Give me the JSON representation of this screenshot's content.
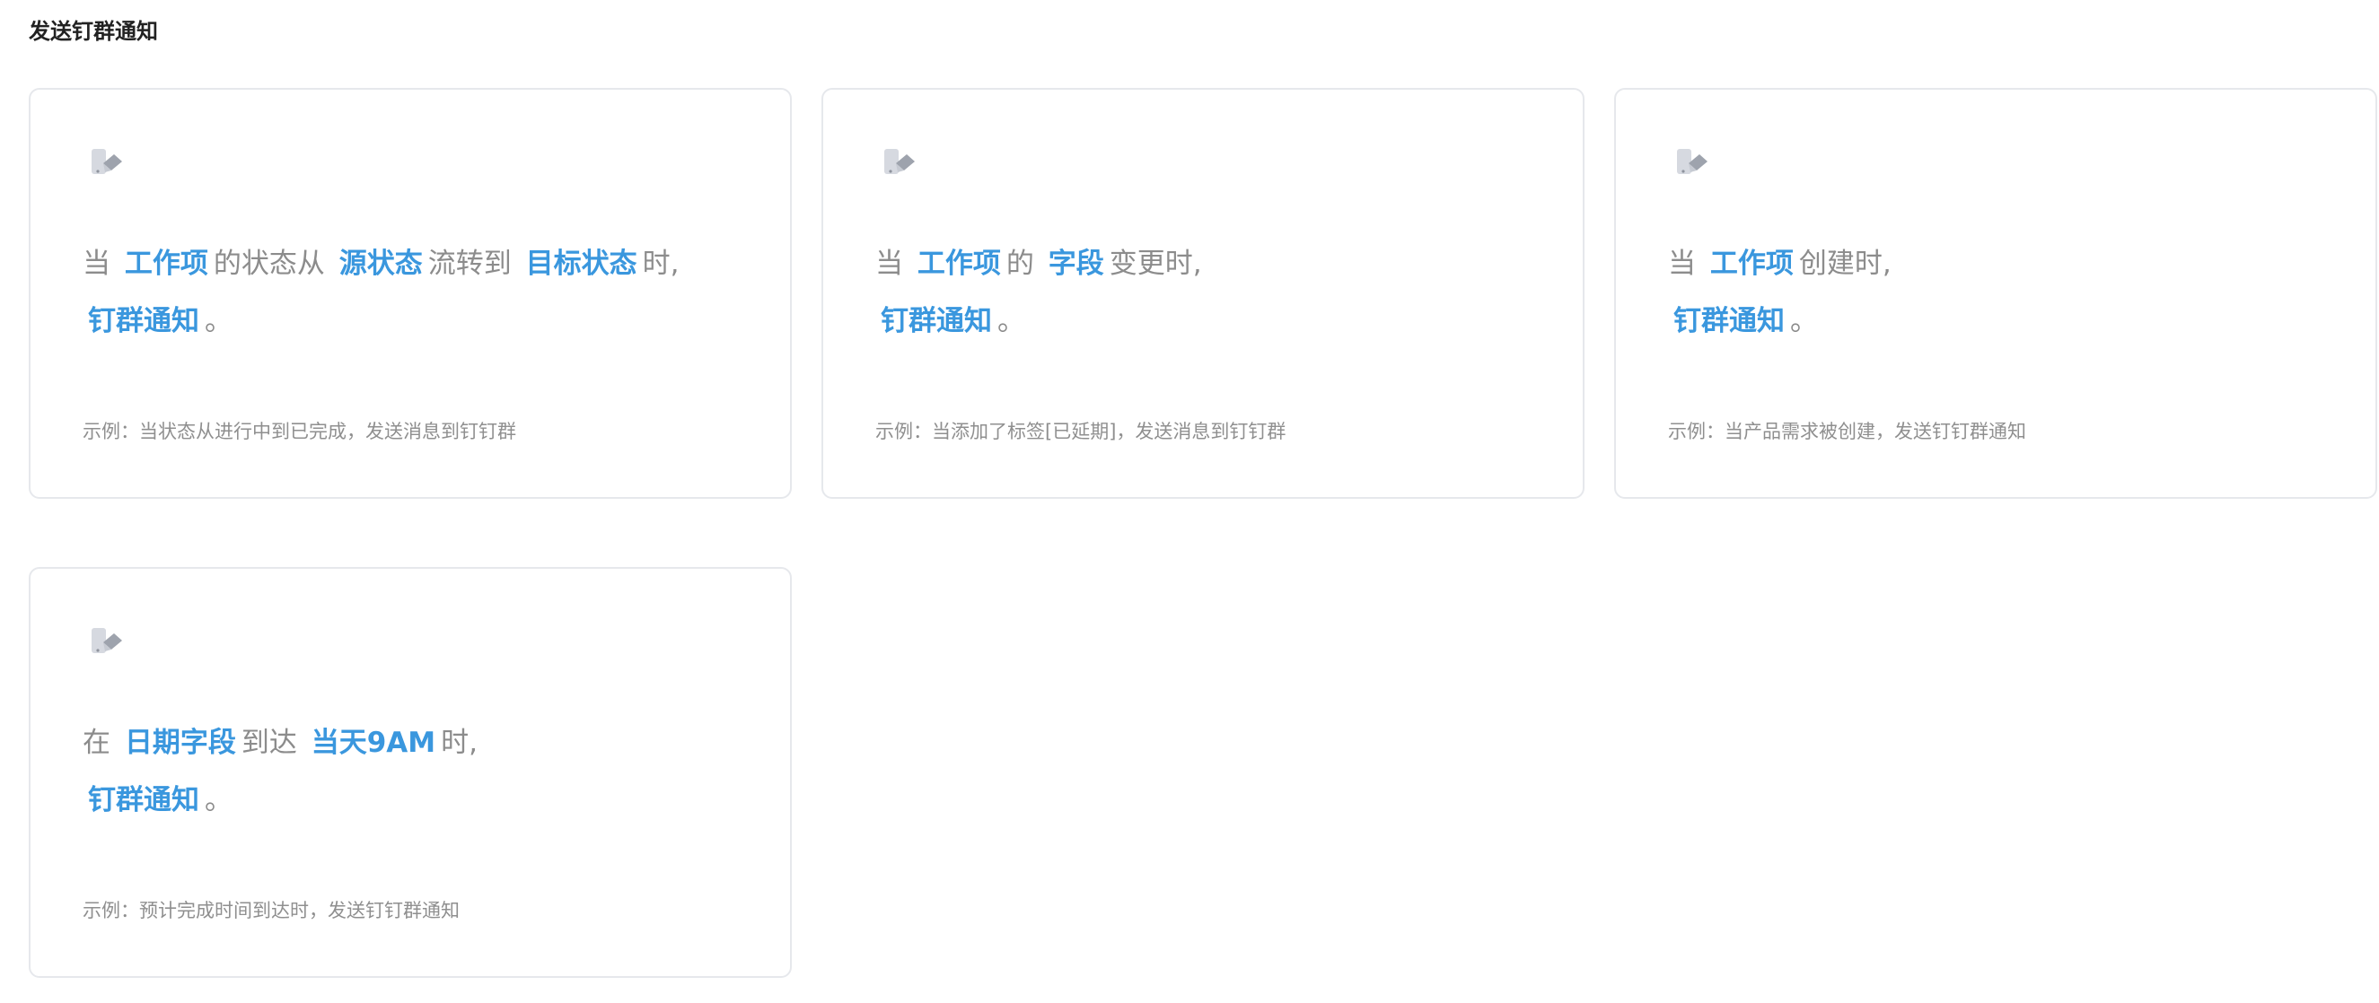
{
  "page": {
    "title": "发送钉群通知"
  },
  "cards": [
    {
      "icon": "pen-icon",
      "line1": [
        {
          "t": "当",
          "hl": false
        },
        {
          "t": "工作项",
          "hl": true
        },
        {
          "t": "的状态从",
          "hl": false
        },
        {
          "t": "源状态",
          "hl": true
        },
        {
          "t": "流转到",
          "hl": false
        },
        {
          "t": "目标状态",
          "hl": true
        },
        {
          "t": "时,",
          "hl": false
        }
      ],
      "line2": [
        {
          "t": "钉群通知",
          "hl": true
        },
        {
          "t": "。",
          "hl": false
        }
      ],
      "example": "示例：当状态从进行中到已完成，发送消息到钉钉群"
    },
    {
      "icon": "pen-icon",
      "line1": [
        {
          "t": "当",
          "hl": false
        },
        {
          "t": "工作项",
          "hl": true
        },
        {
          "t": "的",
          "hl": false
        },
        {
          "t": "字段",
          "hl": true
        },
        {
          "t": "变更时,",
          "hl": false
        }
      ],
      "line2": [
        {
          "t": "钉群通知",
          "hl": true
        },
        {
          "t": "。",
          "hl": false
        }
      ],
      "example": "示例：当添加了标签[已延期]，发送消息到钉钉群"
    },
    {
      "icon": "pen-icon",
      "line1": [
        {
          "t": "当",
          "hl": false
        },
        {
          "t": "工作项",
          "hl": true
        },
        {
          "t": "创建时,",
          "hl": false
        }
      ],
      "line2": [
        {
          "t": "钉群通知",
          "hl": true
        },
        {
          "t": "。",
          "hl": false
        }
      ],
      "example": "示例：当产品需求被创建，发送钉钉群通知"
    },
    {
      "icon": "pen-icon",
      "line1": [
        {
          "t": "在",
          "hl": false
        },
        {
          "t": "日期字段",
          "hl": true
        },
        {
          "t": "到达",
          "hl": false
        },
        {
          "t": "当天9AM",
          "hl": true
        },
        {
          "t": "时,",
          "hl": false
        }
      ],
      "line2": [
        {
          "t": "钉群通知",
          "hl": true
        },
        {
          "t": "。",
          "hl": false
        }
      ],
      "example": "示例：预计完成时间到达时，发送钉钉群通知"
    }
  ]
}
